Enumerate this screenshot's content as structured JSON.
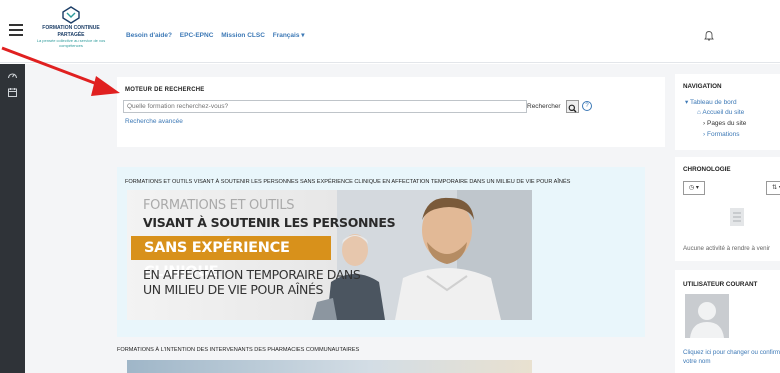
{
  "header": {
    "logo_line1": "FORMATION CONTINUE",
    "logo_line2": "PARTAGÉE",
    "logo_tagline": "La pensée collective au service de vos compétences",
    "nav": [
      "Besoin d'aide?",
      "EPC-EPNC",
      "Mission CLSC",
      "Français ▾"
    ]
  },
  "search": {
    "title": "MOTEUR DE RECHERCHE",
    "placeholder": "Quelle formation recherchez-vous?",
    "label": "Rechercher",
    "advanced_link": "Recherche avancée"
  },
  "courses": [
    {
      "title": "FORMATIONS ET OUTILS VISANT À SOUTENIR LES PERSONNES SANS EXPÉRIENCE CLINIQUE EN AFFECTATION TEMPORAIRE DANS UN MILIEU DE VIE POUR AÎNÉS",
      "banner_line1": "FORMATIONS ET OUTILS",
      "banner_line2": "VISANT À SOUTENIR LES PERSONNES",
      "banner_line3": "SANS EXPÉRIENCE CLINIQUE",
      "banner_line4": "EN AFFECTATION TEMPORAIRE DANS",
      "banner_line5": "UN MILIEU DE VIE POUR AÎNÉS"
    },
    {
      "title": "FORMATIONS À L'INTENTION DES INTERVENANTS DES PHARMACIES COMMUNAUTAIRES"
    }
  ],
  "navigation": {
    "title": "NAVIGATION",
    "dashboard": "Tableau de bord",
    "home": "Accueil du site",
    "pages": "Pages du site",
    "formations": "Formations"
  },
  "timeline": {
    "title": "CHRONOLOGIE",
    "empty": "Aucune activité à rendre à venir"
  },
  "user": {
    "title": "UTILISATEUR COURANT",
    "link": "Cliquez ici pour changer ou confirmer votre nom"
  },
  "colors": {
    "accent": "#3d79b6",
    "rail": "#2f3338",
    "banner_highlight": "#d8911b",
    "arrow": "#e02020"
  }
}
